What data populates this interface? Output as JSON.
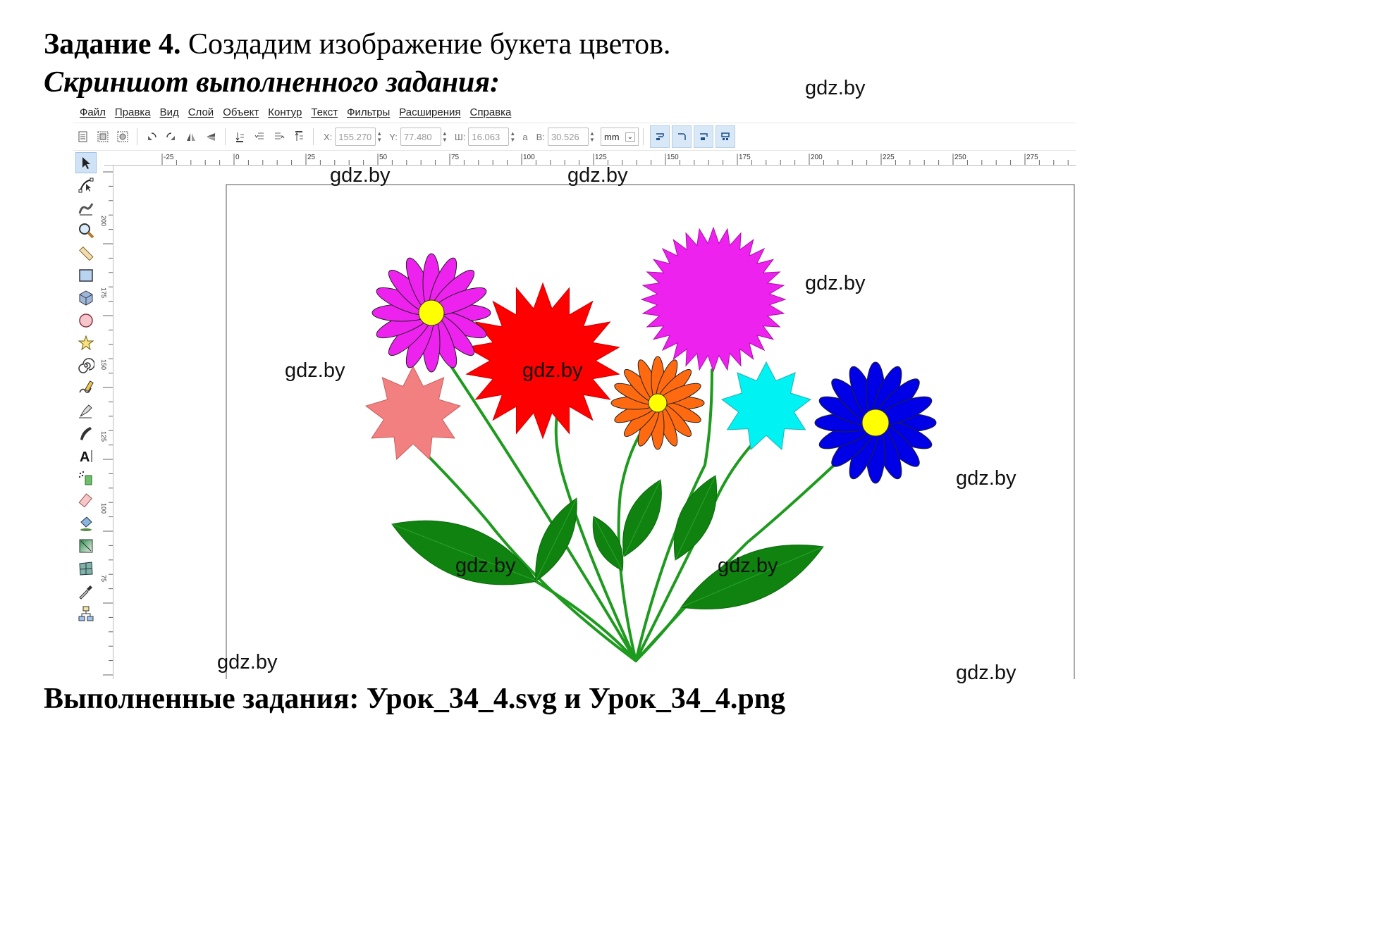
{
  "header": {
    "task_label": "Задание 4.",
    "task_text": "Создадим изображение букета цветов.",
    "subtitle": "Скриншот выполненного задания:"
  },
  "footer": {
    "text": "Выполненные задания: Урок_34_4.svg и Урок_34_4.png"
  },
  "watermark": "gdz.by",
  "menu": {
    "items": [
      "Файл",
      "Правка",
      "Вид",
      "Слой",
      "Объект",
      "Контур",
      "Текст",
      "Фильтры",
      "Расширения",
      "Справка"
    ]
  },
  "toolbar": {
    "x_label": "X:",
    "x_value": "155.270",
    "y_label": "Y:",
    "y_value": "77.480",
    "w_label": "Ш:",
    "w_value": "16.063",
    "lock_glyph": "a",
    "h_label": "В:",
    "h_value": "30.526",
    "unit": "mm"
  },
  "ruler": {
    "ticks": [
      "-25",
      "0",
      "25",
      "50",
      "75",
      "100",
      "125",
      "150",
      "175",
      "200",
      "225",
      "250",
      "275"
    ],
    "vticks": [
      "200",
      "175",
      "150",
      "125",
      "100",
      "75"
    ]
  },
  "tools": [
    "selector-tool",
    "node-tool",
    "tweak-tool",
    "zoom-tool",
    "measure-tool",
    "rectangle-tool",
    "box3d-tool",
    "ellipse-tool",
    "star-tool",
    "spiral-tool",
    "pencil-tool",
    "pen-tool",
    "calligraphy-tool",
    "text-tool",
    "spray-tool",
    "eraser-tool",
    "paint-bucket-tool",
    "gradient-tool",
    "mesh-tool",
    "dropper-tool",
    "connector-tool"
  ],
  "colors": {
    "stem": "#1e9a1e",
    "leaf": "#0f820f",
    "magenta_daisy": "#ee22ee",
    "red_star": "#ff0000",
    "magenta_burst": "#ee22ee",
    "pink_star": "#f38080",
    "orange_daisy": "#ff6a10",
    "cyan_star": "#00f2f2",
    "blue_daisy": "#0000e6",
    "center": "#ffff00"
  }
}
